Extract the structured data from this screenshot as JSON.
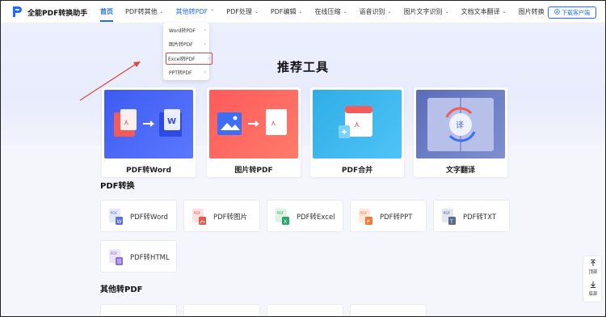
{
  "header": {
    "brand": "全能PDF转换助手",
    "nav": [
      {
        "label": "首页",
        "active": true,
        "chevron": false
      },
      {
        "label": "PDF转其他",
        "chevron": true
      },
      {
        "label": "其他转PDF",
        "chevron": true,
        "open": true
      },
      {
        "label": "PDF处理",
        "chevron": true
      },
      {
        "label": "PDF编辑",
        "chevron": true
      },
      {
        "label": "在线压缩",
        "chevron": true
      },
      {
        "label": "语音识别",
        "chevron": true
      },
      {
        "label": "图片文字识别",
        "chevron": true
      },
      {
        "label": "文档文本翻译",
        "chevron": true
      },
      {
        "label": "图片转换",
        "chevron": true
      }
    ],
    "download_label": "下载客户端"
  },
  "dropdown": {
    "items": [
      {
        "label": "Word转PDF"
      },
      {
        "label": "图片转PDF"
      },
      {
        "label": "Excel转PDF",
        "highlighted": true
      },
      {
        "label": "PPT转PDF"
      }
    ]
  },
  "hero": {
    "title": "推荐工具"
  },
  "featured": [
    {
      "label": "PDF转Word"
    },
    {
      "label": "图片转PDF"
    },
    {
      "label": "PDF合并"
    },
    {
      "label": "文字翻译"
    }
  ],
  "sections": {
    "pdf_to_other": {
      "title": "PDF转换",
      "tools": [
        {
          "label": "PDF转Word",
          "color": "#5b6fd8"
        },
        {
          "label": "PDF转图片",
          "color": "#e35a4c"
        },
        {
          "label": "PDF转Excel",
          "color": "#2fa56a"
        },
        {
          "label": "PDF转PPT",
          "color": "#ee7a3e"
        },
        {
          "label": "PDF转TXT",
          "color": "#5d6990"
        },
        {
          "label": "PDF转HTML",
          "color": "#8a6fd8"
        }
      ]
    },
    "other_to_pdf": {
      "title": "其他转PDF"
    }
  },
  "side": {
    "top_label": "顶部",
    "bottom_label": "底部"
  },
  "colors": {
    "accent": "#1f6bff",
    "highlight_box": "#e0463c"
  }
}
